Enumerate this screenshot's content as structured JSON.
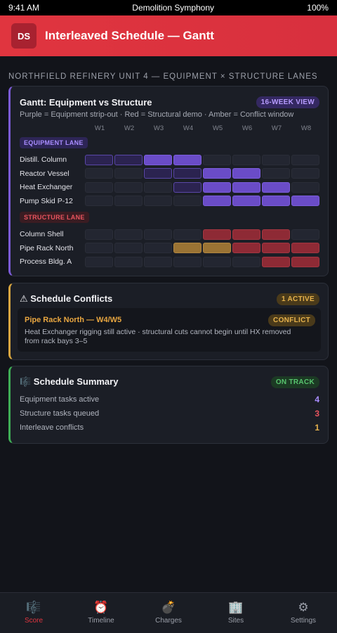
{
  "status_bar": {
    "time": "9:41 AM",
    "title": "Demolition Symphony",
    "battery": "100%"
  },
  "header": {
    "logo": "DS",
    "title": "Interleaved Schedule — Gantt"
  },
  "section_title": "NORTHFIELD REFINERY UNIT 4 — EQUIPMENT × STRUCTURE LANES",
  "gantt": {
    "title": "Gantt: Equipment vs Structure",
    "badge": "16-WEEK VIEW",
    "legend": "Purple = Equipment strip-out · Red = Structural demo · Amber = Conflict window",
    "weeks": [
      "W1",
      "W2",
      "W3",
      "W4",
      "W5",
      "W6",
      "W7",
      "W8"
    ],
    "equipment_lane_label": "EQUIPMENT LANE",
    "structure_lane_label": "STRUCTURE LANE",
    "cell_states_legend": {
      "e": "empty",
      "pd": "equipment planned",
      "pb": "equipment active",
      "r": "structural demo",
      "a": "conflict window"
    },
    "equipment_rows": [
      {
        "label": "Distill. Column",
        "cells": [
          "pd",
          "pd",
          "pb",
          "pb",
          "e",
          "e",
          "e",
          "e"
        ]
      },
      {
        "label": "Reactor Vessel",
        "cells": [
          "e",
          "e",
          "pd",
          "pd",
          "pb",
          "pb",
          "e",
          "e"
        ]
      },
      {
        "label": "Heat Exchanger",
        "cells": [
          "e",
          "e",
          "e",
          "pd",
          "pb",
          "pb",
          "pb",
          "e"
        ]
      },
      {
        "label": "Pump Skid P-12",
        "cells": [
          "e",
          "e",
          "e",
          "e",
          "pb",
          "pb",
          "pb",
          "pb"
        ]
      }
    ],
    "structure_rows": [
      {
        "label": "Column Shell",
        "cells": [
          "e",
          "e",
          "e",
          "e",
          "r",
          "r",
          "r",
          "e"
        ]
      },
      {
        "label": "Pipe Rack North",
        "cells": [
          "e",
          "e",
          "e",
          "a",
          "a",
          "r",
          "r",
          "r"
        ]
      },
      {
        "label": "Process Bldg. A",
        "cells": [
          "e",
          "e",
          "e",
          "e",
          "e",
          "e",
          "r",
          "r"
        ]
      }
    ],
    "colors": {
      "equipment": "#6a4cc7",
      "structure": "#8e2a35",
      "conflict": "#9a7334"
    }
  },
  "conflicts": {
    "title": "⚠ Schedule Conflicts",
    "badge": "1 ACTIVE",
    "item": {
      "title": "Pipe Rack North — W4/W5",
      "badge": "CONFLICT",
      "description": "Heat Exchanger rigging still active · structural cuts cannot begin until HX removed from rack bays 3–5"
    }
  },
  "summary": {
    "title": "🎼 Schedule Summary",
    "badge": "ON TRACK",
    "rows": [
      {
        "label": "Equipment tasks active",
        "value": "4",
        "color": "#a98dff"
      },
      {
        "label": "Structure tasks queued",
        "value": "3",
        "color": "#e8545e"
      },
      {
        "label": "Interleave conflicts",
        "value": "1",
        "color": "#e6b24c"
      }
    ]
  },
  "nav": [
    {
      "icon": "🎼",
      "icon_name": "score-icon",
      "label": "Score",
      "active": true
    },
    {
      "icon": "⏰",
      "icon_name": "timeline-icon",
      "label": "Timeline",
      "active": false
    },
    {
      "icon": "💣",
      "icon_name": "charges-icon",
      "label": "Charges",
      "active": false
    },
    {
      "icon": "🏢",
      "icon_name": "sites-icon",
      "label": "Sites",
      "active": false
    },
    {
      "icon": "⚙",
      "icon_name": "settings-icon",
      "label": "Settings",
      "active": false
    }
  ]
}
